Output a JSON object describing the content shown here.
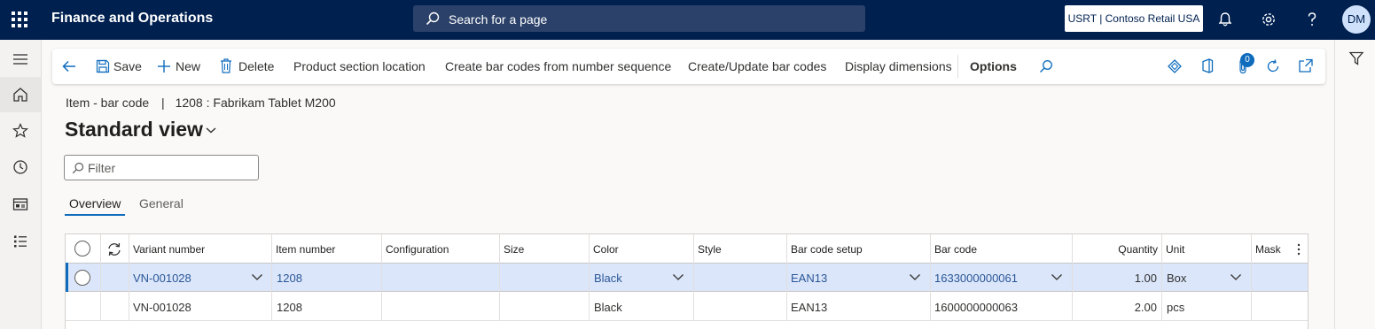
{
  "topbar": {
    "app_title": "Finance and Operations",
    "search_placeholder": "Search for a page",
    "company": "USRT | Contoso Retail USA",
    "user_initials": "DM",
    "icons": [
      "waffle-icon",
      "search-icon",
      "bell-icon",
      "gear-icon",
      "help-icon"
    ]
  },
  "leftnav": {
    "items": [
      "menu-icon",
      "home-icon",
      "star-icon",
      "clock-icon",
      "workspace-icon",
      "list-icon"
    ]
  },
  "actionpane": {
    "back": "back-icon",
    "save": "Save",
    "new": "New",
    "delete": "Delete",
    "product_section_location": "Product section location",
    "create_from_sequence": "Create bar codes from number sequence",
    "create_update": "Create/Update bar codes",
    "display_dimensions": "Display dimensions",
    "options": "Options",
    "attachment_count": "0"
  },
  "breadcrumb": {
    "form": "Item - bar code",
    "separator": "|",
    "record": "1208 : Fabrikam Tablet M200"
  },
  "page_title": "Standard view",
  "filter": {
    "placeholder": "Filter"
  },
  "tabs": [
    {
      "label": "Overview",
      "selected": true
    },
    {
      "label": "General",
      "selected": false
    }
  ],
  "grid": {
    "columns": [
      "Variant number",
      "Item number",
      "Configuration",
      "Size",
      "Color",
      "Style",
      "Bar code setup",
      "Bar code",
      "Quantity",
      "Unit",
      "Mask"
    ],
    "rows": [
      {
        "variant": "VN-001028",
        "item": "1208",
        "configuration": "",
        "size": "",
        "color": "Black",
        "style": "",
        "setup": "EAN13",
        "barcode": "1633000000061",
        "quantity": "1.00",
        "unit": "Box",
        "mask": "",
        "selected": true
      },
      {
        "variant": "VN-001028",
        "item": "1208",
        "configuration": "",
        "size": "",
        "color": "Black",
        "style": "",
        "setup": "EAN13",
        "barcode": "1600000000063",
        "quantity": "2.00",
        "unit": "pcs",
        "mask": "",
        "selected": false
      }
    ]
  },
  "colors": {
    "topbar_bg": "#002050",
    "accent": "#0f6cbd",
    "selected_row": "#dbe6fa",
    "link": "#2b5797"
  }
}
